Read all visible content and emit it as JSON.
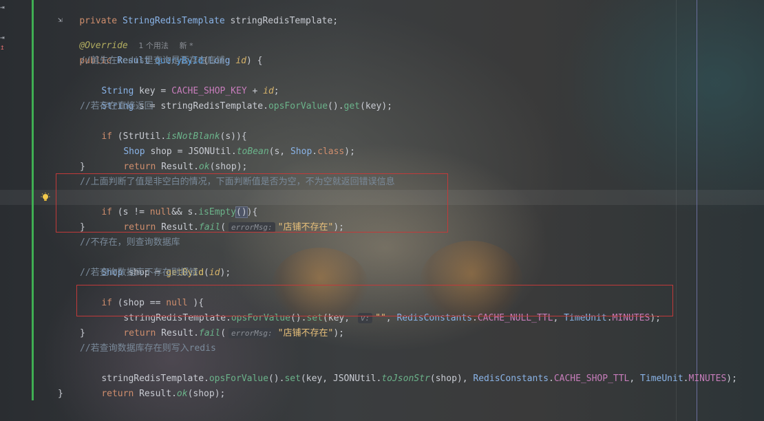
{
  "lines": {
    "l1_kw": "private",
    "l1_type": "StringRedisTemplate",
    "l1_rest": " stringRedisTemplate;",
    "l2": "@Override",
    "l2_usages": "1 个用法",
    "l2_new": "新 *",
    "l3_kw": "public",
    "l3_type": "Result",
    "l3_fn": "queryById",
    "l3_ptype": "Long",
    "l3_param": "id",
    "l4": "//首先在redis里查询是否存在店铺",
    "l5_type": "String",
    "l5_a": " key = ",
    "l5_const": "CACHE_SHOP_KEY",
    "l5_b": " + ",
    "l5_id": "id",
    "l6_type": "String",
    "l6_a": " s = stringRedisTemplate.",
    "l6_m1": "opsForValue",
    "l6_b": "().",
    "l6_m2": "get",
    "l6_c": "(key);",
    "l7": "//若存在直接返回",
    "l8_kw": "if",
    "l8_a": " (StrUtil.",
    "l8_m": "isNotBlank",
    "l8_b": "(s)){",
    "l9_type": "Shop",
    "l9_a": " shop = JSONUtil.",
    "l9_m": "toBean",
    "l9_b": "(s, ",
    "l9_t2": "Shop",
    "l9_c": ".",
    "l9_kw": "class",
    "l9_d": ");",
    "l10_kw": "return",
    "l10_a": " Result.",
    "l10_m": "ok",
    "l10_b": "(shop);",
    "l11": "}",
    "l12": "//上面判断了值是非空白的情况，下面判断值是否为空，不为空就返回错误信息",
    "l13_kw": "if",
    "l13_a": " (s != ",
    "l13_null": "null",
    "l13_b": "&& s.",
    "l13_m": "isEmpty",
    "l13_sel": "()",
    "l13_c": "){",
    "l14_kw": "return",
    "l14_a": " Result.",
    "l14_m": "fail",
    "l14_b": "(",
    "l14_hint": "errorMsg:",
    "l14_str": "\"店铺不存在\"",
    "l14_c": ");",
    "l15": "}",
    "l16": "//不存在，则查询数据库",
    "l17_type": "Shop",
    "l17_a": " shop = ",
    "l17_m": "getById",
    "l17_b": "(",
    "l17_id": "id",
    "l17_c": ");",
    "l18": "//若查询数据库不存在则报错",
    "l19_kw": "if",
    "l19_a": " (shop == ",
    "l19_null": "null",
    "l19_b": " ){",
    "l20_a": "stringRedisTemplate.",
    "l20_m1": "opsForValue",
    "l20_b": "().",
    "l20_m2": "set",
    "l20_c": "(key, ",
    "l20_hint": "v:",
    "l20_str": "\"\"",
    "l20_d": ", ",
    "l20_t": "RedisConstants",
    "l20_e": ".",
    "l20_const": "CACHE_NULL_TTL",
    "l20_f": ", ",
    "l20_t2": "TimeUnit",
    "l20_g": ".",
    "l20_const2": "MINUTES",
    "l20_h": ");",
    "l21_kw": "return",
    "l21_a": " Result.",
    "l21_m": "fail",
    "l21_b": "(",
    "l21_hint": "errorMsg:",
    "l21_str": "\"店铺不存在\"",
    "l21_c": ");",
    "l22": "}",
    "l23": "//若查询数据库存在则写入redis",
    "l24_a": "stringRedisTemplate.",
    "l24_m1": "opsForValue",
    "l24_b": "().",
    "l24_m2": "set",
    "l24_c": "(key, JSONUtil.",
    "l24_m3": "toJsonStr",
    "l24_d": "(shop), ",
    "l24_t": "RedisConstants",
    "l24_e": ".",
    "l24_const": "CACHE_SHOP_TTL",
    "l24_f": ", ",
    "l24_t2": "TimeUnit",
    "l24_g": ".",
    "l24_const2": "MINUTES",
    "l24_h": ");",
    "l25_kw": "return",
    "l25_a": " Result.",
    "l25_m": "ok",
    "l25_b": "(shop);",
    "l26": "}"
  },
  "colors": {
    "comment": "#7a8a9a",
    "keyword": "#cf8e6d",
    "string": "#6aab73",
    "highlight_box": "#c23a3a",
    "vcs_change_bar": "#3fae52"
  },
  "icons": [
    "gutter-arrow-icon",
    "override-marker-icon",
    "lightbulb-icon"
  ]
}
